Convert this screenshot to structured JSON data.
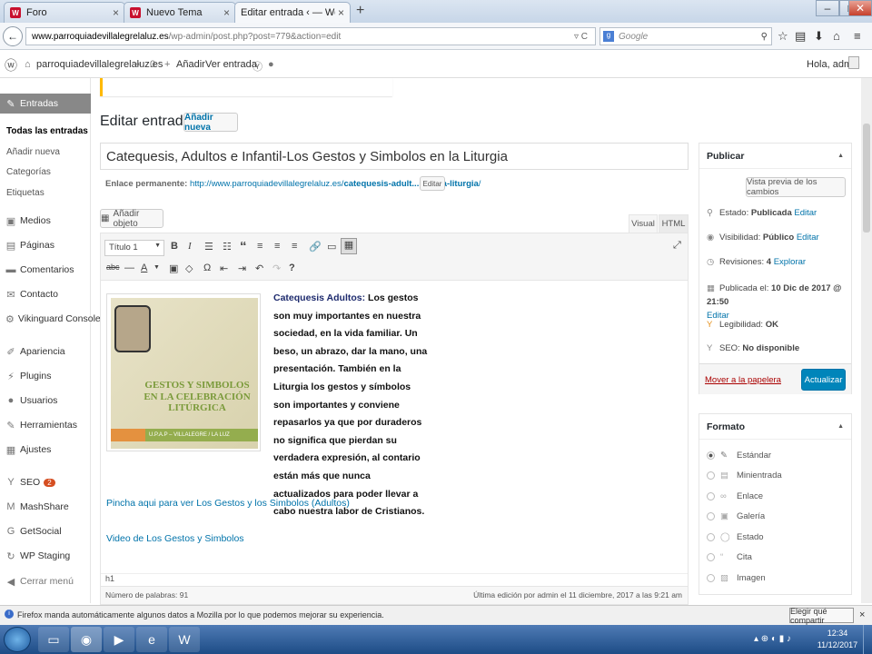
{
  "browser": {
    "tabs": [
      {
        "label": "Foro",
        "favicon": "wp-red-icon"
      },
      {
        "label": "Nuevo Tema",
        "favicon": "wp-red-icon"
      },
      {
        "label": "Editar entrada ‹ — WordPress",
        "favicon": ""
      }
    ],
    "new_tab": "+",
    "url_domain": "www.parroquiadevillalegrelaluz.es",
    "url_path": "/wp-admin/post.php?post=779&action=edit",
    "search_placeholder": "Google"
  },
  "adminbar": {
    "site": "parroquiadevillalegrelaluz.es",
    "comments_count": "0",
    "new_label": "Añadir",
    "view_label": "Ver entrada",
    "greeting": "Hola, admin"
  },
  "sidebar": {
    "entradas": "Entradas",
    "sub": [
      "Todas las entradas",
      "Añadir nueva",
      "Categorías",
      "Etiquetas"
    ],
    "items": [
      "Medios",
      "Páginas",
      "Comentarios",
      "Contacto",
      "Vikinguard Console",
      "Apariencia",
      "Plugins",
      "Usuarios",
      "Herramientas",
      "Ajustes",
      "SEO",
      "MashShare",
      "GetSocial",
      "WP Staging",
      "Cerrar menú"
    ],
    "seo_badge": "2"
  },
  "main": {
    "title": "Editar entrada",
    "add_new": "Añadir nueva",
    "post_title": "Catequesis, Adultos e Infantil-Los Gestos y Simbolos en la Liturgia",
    "permalink_label": "Enlace permanente:",
    "permalink_base": "http://www.parroquiadevillalegrelaluz.es/",
    "permalink_slug": "catequesis-adult...s-en-la-liturgia",
    "permalink_end": "/",
    "edit_slug": "Editar",
    "add_media": "Añadir objeto",
    "tab_visual": "Visual",
    "tab_html": "HTML",
    "format_select": "Título 1",
    "image_title": "GESTOS Y SIMBOLOS EN LA CELEBRACIÓN LITÚRGICA",
    "image_footer": "U.P.A.P – VILLALEGRE / LA LUZ",
    "body_lead": "Catequesis Adultos:",
    "body_text": "Los gestos son muy importantes en nuestra sociedad, en la vida familiar. Un beso, un abrazo, dar la mano, una presentación. También en la Liturgia los gestos y símbolos son importantes y conviene repasarlos ya que por duraderos no significa que pierdan su verdadera expresión, al contario están más que nunca actualizados para poder llevar a cabo nuestra labor de Cristianos.",
    "link1": "Pincha aqui para ver Los Gestos y los Simbolos (Adultos)",
    "link2": "Video de Los Gestos y Simbolos",
    "path": "h1",
    "word_count": "Número de palabras: 91",
    "last_edit": "Última edición por admin el 11 diciembre, 2017 a las 9:21 am"
  },
  "publish": {
    "title": "Publicar",
    "preview": "Vista previa de los cambios",
    "status_label": "Estado:",
    "status_value": "Publicada",
    "visibility_label": "Visibilidad:",
    "visibility_value": "Público",
    "revisions_label": "Revisiones:",
    "revisions_value": "4",
    "explore": "Explorar",
    "published_label": "Publicada el:",
    "published_value": "10 Dic de 2017 @ 21:50",
    "edit": "Editar",
    "readability_label": "Legibilidad:",
    "readability_value": "OK",
    "seo_label": "SEO:",
    "seo_value": "No disponible",
    "trash": "Mover a la papelera",
    "update": "Actualizar"
  },
  "format": {
    "title": "Formato",
    "options": [
      "Estándar",
      "Minientrada",
      "Enlace",
      "Galería",
      "Estado",
      "Cita",
      "Imagen"
    ],
    "selected": "Estándar"
  },
  "notification": {
    "text": "Firefox manda automáticamente algunos datos a Mozilla por lo que podemos mejorar su experiencia.",
    "button": "Elegir qué compartir"
  },
  "taskbar": {
    "time": "12:34",
    "date": "11/12/2017"
  },
  "colors": {
    "accent": "#0073aa",
    "update_button": "#0085ba",
    "trash": "#a00",
    "sidebar_current": "#888888"
  }
}
